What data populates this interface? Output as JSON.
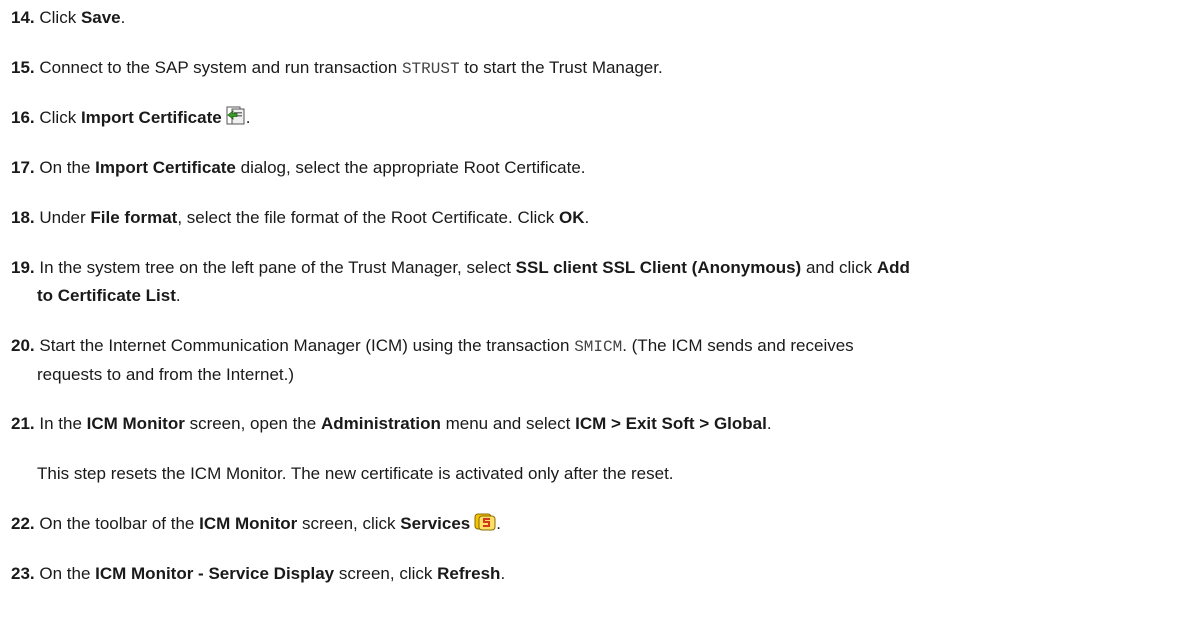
{
  "steps": [
    {
      "num": "14.",
      "t1": "Click ",
      "b1": "Save",
      "t2": "."
    },
    {
      "num": "15.",
      "t1": "Connect to the SAP system and run transaction ",
      "code": "STRUST",
      "t2": " to start the Trust Manager."
    },
    {
      "num": "16.",
      "t1": "Click ",
      "b1": "Import Certificate",
      "t2": ".",
      "icon": "import-certificate-icon"
    },
    {
      "num": "17.",
      "t1": "On the ",
      "b1": "Import Certificate",
      "t2": " dialog, select the appropriate Root Certificate."
    },
    {
      "num": "18.",
      "t1": "Under ",
      "b1": "File format",
      "t2": ", select the file format of the Root Certificate. Click ",
      "b2": "OK",
      "t3": "."
    },
    {
      "num": "19.",
      "t1": "In the system tree on the left pane of the Trust Manager, select ",
      "b1": "SSL client SSL Client (Anonymous)",
      "t2": " and click ",
      "b2a": "Add",
      "b2b": "to Certificate List",
      "t3": "."
    },
    {
      "num": "20.",
      "t1": "Start the Internet Communication Manager (ICM) using the transaction ",
      "code": "SMICM",
      "t2": ". (The ICM sends and receives",
      "t3": "requests to and from the Internet.)"
    },
    {
      "num": "21.",
      "t1": "In the ",
      "b1": "ICM Monitor",
      "t2": " screen, open the ",
      "b2": "Administration",
      "t3": " menu and select ",
      "b3": "ICM > Exit Soft > Global",
      "t4": ".",
      "note": "This step resets the ICM Monitor. The new certificate is activated only after the reset."
    },
    {
      "num": "22.",
      "t1": "On the toolbar of the ",
      "b1": "ICM Monitor",
      "t2": " screen, click ",
      "b2": "Services",
      "t3": ".",
      "icon": "services-icon"
    },
    {
      "num": "23.",
      "t1": "On the ",
      "b1": "ICM Monitor - Service Display",
      "t2": " screen, click ",
      "b2": "Refresh",
      "t3": "."
    }
  ],
  "colors": {
    "text": "#1a1a1a",
    "code": "#444444",
    "icon_green": "#3a9a2a",
    "icon_yellow": "#f5c400",
    "icon_red": "#d23a1a"
  }
}
